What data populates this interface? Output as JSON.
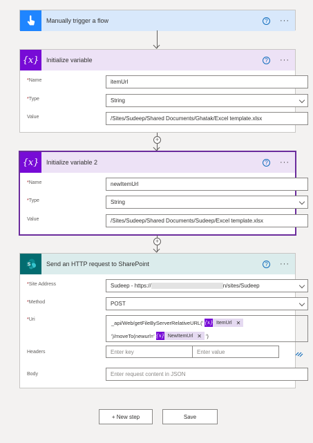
{
  "trigger": {
    "title": "Manually trigger a flow"
  },
  "init1": {
    "title": "Initialize variable",
    "name_label": "Name",
    "name_value": "itemUrl",
    "type_label": "Type",
    "type_value": "String",
    "value_label": "Value",
    "value_value": "/Sites/Sudeep/Shared Documents/Ghatak/Excel template.xlsx"
  },
  "init2": {
    "title": "Initialize variable 2",
    "name_label": "Name",
    "name_value": "newItemUrl",
    "type_label": "Type",
    "type_value": "String",
    "value_label": "Value",
    "value_value": "/Sites/Sudeep/Shared Documents/Sudeep/Excel template.xlsx"
  },
  "http": {
    "title": "Send an HTTP request to SharePoint",
    "site_label": "Site Address",
    "site_prefix": "Sudeep - https://",
    "site_suffix": "n/sites/Sudeep",
    "method_label": "Method",
    "method_value": "POST",
    "uri_label": "Uri",
    "uri_line1": "_api/Web/getFileByServerRelativeURL('",
    "uri_token1": "ItemUrl",
    "uri_line2a": "')/moveTo(newurl='",
    "uri_token2": "NewItemUrl",
    "uri_line2b": "')",
    "headers_label": "Headers",
    "headers_key_placeholder": "Enter key",
    "headers_value_placeholder": "Enter value",
    "body_label": "Body",
    "body_placeholder": "Enter request content in JSON"
  },
  "footer": {
    "new_step": "+ New step",
    "save": "Save"
  },
  "symbols": {
    "required": "*",
    "help": "?",
    "more": "···",
    "plus": "+",
    "var": "{x}",
    "close": "✕"
  },
  "icons": {
    "trigger": "touch-hand-icon",
    "variable": "variable-braces-icon",
    "sharepoint": "sharepoint-icon"
  },
  "colors": {
    "trigger_header": "#d8e8fb",
    "trigger_icon": "#1f85ff",
    "variable_header": "#ede2f6",
    "variable_icon": "#770bd6",
    "sharepoint_header": "#dbecec",
    "sharepoint_icon": "#036c70",
    "selected_border": "#6a2b9c"
  }
}
